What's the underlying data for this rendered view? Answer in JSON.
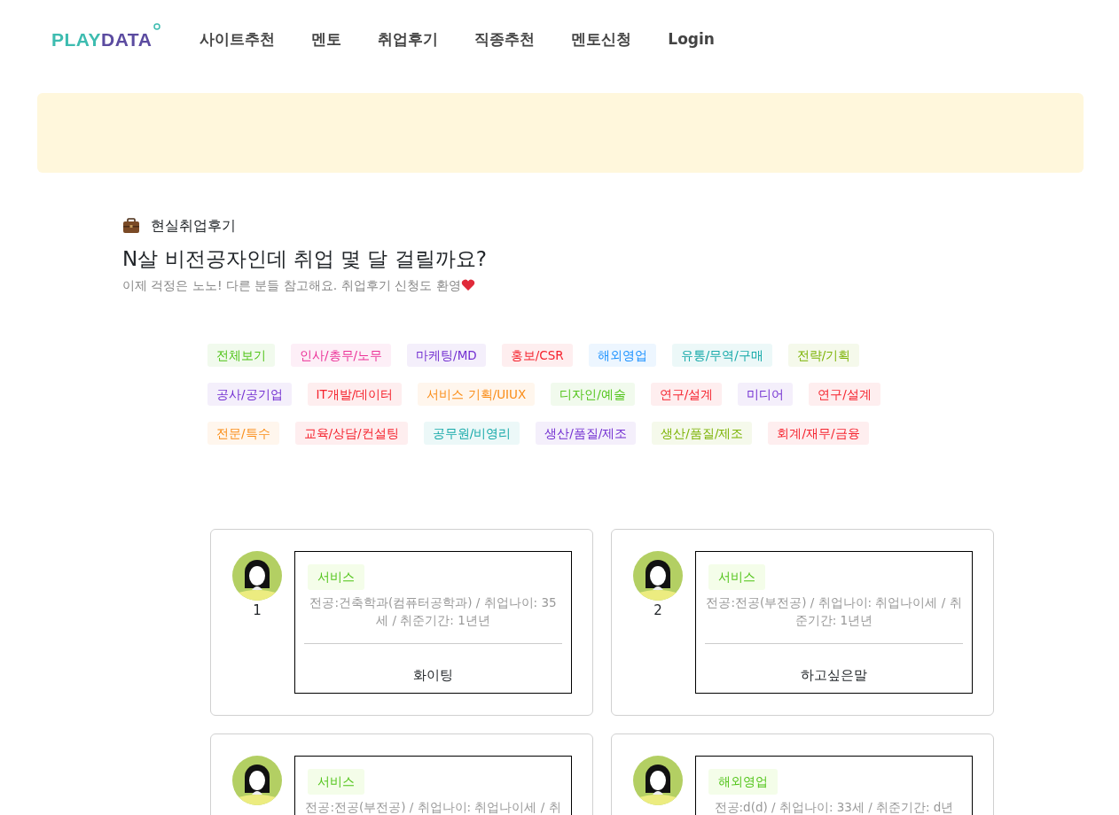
{
  "logo": {
    "first": "PLAY",
    "second": "DATA"
  },
  "nav": [
    "사이트추천",
    "멘토",
    "취업후기",
    "직종추천",
    "멘토신청",
    "Login"
  ],
  "header": {
    "category": "현실취업후기",
    "title": "N살 비전공자인데 취업 몇 달 걸릴까요?",
    "subtitle": "이제 걱정은 노노! 다른 분들 참고해요. 취업후기 신청도 환영"
  },
  "tag_rows": [
    [
      {
        "label": "전체보기",
        "color": "#52c41a"
      },
      {
        "label": "인사/총무/노무",
        "color": "#eb2f96"
      },
      {
        "label": "마케팅/MD",
        "color": "#722ed1"
      },
      {
        "label": "홍보/CSR",
        "color": "#f5222d"
      },
      {
        "label": "해외영업",
        "color": "#1890ff"
      },
      {
        "label": "유통/무역/구매",
        "color": "#13a8a8"
      },
      {
        "label": "전략/기획",
        "color": "#7cb305"
      }
    ],
    [
      {
        "label": "공사/공기업",
        "color": "#722ed1"
      },
      {
        "label": "IT개발/데이터",
        "color": "#f5222d"
      },
      {
        "label": "서비스 기획/UIUX",
        "color": "#fa8c16"
      },
      {
        "label": "디자인/예술",
        "color": "#52c41a"
      },
      {
        "label": "연구/설계",
        "color": "#f5222d"
      },
      {
        "label": "미디어",
        "color": "#722ed1"
      },
      {
        "label": "연구/설계",
        "color": "#f5222d"
      }
    ],
    [
      {
        "label": "전문/특수",
        "color": "#fa8c16"
      },
      {
        "label": "교육/상담/컨설팅",
        "color": "#f5222d"
      },
      {
        "label": "공무원/비영리",
        "color": "#13a8a8"
      },
      {
        "label": "생산/품질/제조",
        "color": "#722ed1"
      },
      {
        "label": "생산/품질/제조",
        "color": "#7cb305"
      },
      {
        "label": "회계/재무/금융",
        "color": "#f5222d"
      }
    ]
  ],
  "reviews": [
    {
      "number": "1",
      "tag": "서비스",
      "detail": "전공:건축학과(컴퓨터공학과) / 취업나이: 35세 / 취준기간: 1년년",
      "message": "화이팅"
    },
    {
      "number": "2",
      "tag": "서비스",
      "detail": "전공:전공(부전공) / 취업나이: 취업나이세 / 취준기간: 1년년",
      "message": "하고싶은말"
    },
    {
      "tag": "서비스",
      "detail": "전공:전공(부전공) / 취업나이: 취업나이세 / 취"
    },
    {
      "tag": "해외영업",
      "detail": "전공:d(d) / 취업나이: 33세 / 취준기간: d년"
    }
  ]
}
